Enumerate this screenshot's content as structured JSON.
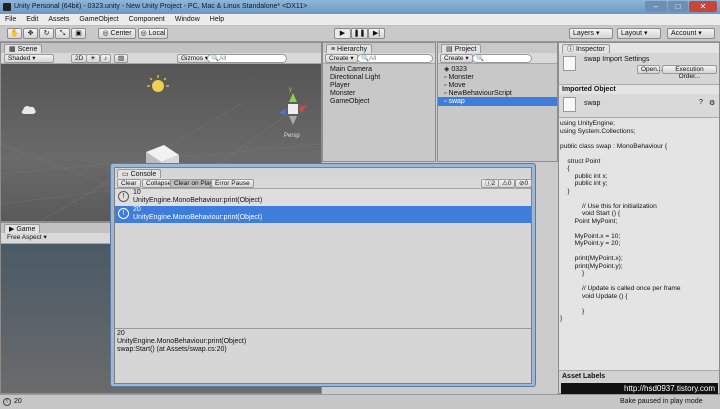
{
  "window": {
    "title": "Unity Personal (64bit) - 0323.unity - New Unity Project - PC, Mac & Linux Standalone* <DX11>"
  },
  "menu": [
    "File",
    "Edit",
    "Assets",
    "GameObject",
    "Component",
    "Window",
    "Help"
  ],
  "toolbar": {
    "center": "Center",
    "local": "Local",
    "layers": "Layers",
    "layout": "Layout",
    "account": "Account"
  },
  "scene": {
    "tab": "Scene",
    "shading": "Shaded",
    "mode2d": "2D",
    "gizmos": "Gizmos",
    "search": "All",
    "persp": "Persp"
  },
  "game": {
    "tab": "Game",
    "aspect": "Free Aspect"
  },
  "hierarchy": {
    "tab": "Hierarchy",
    "create": "Create",
    "search": "All",
    "items": [
      "Main Camera",
      "Directional Light",
      "Player",
      "Monster",
      "GameObject"
    ]
  },
  "project": {
    "tab": "Project",
    "create": "Create",
    "items": [
      "0323",
      "Monster",
      "Move",
      "NewBehaviourScript",
      "swap"
    ],
    "selected": 4
  },
  "inspector": {
    "tab": "Inspector",
    "title": "swap Import Settings",
    "open": "Open...",
    "exec": "Execution Order...",
    "imported": "Imported Object",
    "asset_name": "swap",
    "asset_labels": "Asset Labels",
    "watermark": "http://hsd0937.tistory.com",
    "code": [
      "using UnityEngine;",
      "using System.Collections;",
      "",
      "public class swap : MonoBehaviour {",
      "",
      "    struct Point",
      "    {",
      "        public int x;",
      "        public int y;",
      "    }",
      "",
      "            // Use this for initialization",
      "            void Start () {",
      "        Point MyPoint;",
      "",
      "        MyPoint.x = 10;",
      "        MyPoint.y = 20;",
      "",
      "        print(MyPoint.x);",
      "        print(MyPoint.y);",
      "            }",
      "",
      "            // Update is called once per frame",
      "            void Update () {",
      "",
      "            }",
      "}"
    ]
  },
  "console": {
    "tab": "Console",
    "buttons": [
      "Clear",
      "Collapse",
      "Clear on Play",
      "Error Pause"
    ],
    "counts": [
      "2",
      "0",
      "0"
    ],
    "entries": [
      {
        "line1": "10",
        "line2": "UnityEngine.MonoBehaviour:print(Object)"
      },
      {
        "line1": "20",
        "line2": "UnityEngine.MonoBehaviour:print(Object)"
      }
    ],
    "detail": [
      "20",
      "UnityEngine.MonoBehaviour:print(Object)",
      "swap:Start() (at Assets/swap.cs:20)"
    ]
  },
  "status": {
    "text": "20",
    "right": "Bake paused in play mode"
  },
  "colors": {
    "selection": "#3e7ddb",
    "scene_bg": "#5d5d5d",
    "console_bg": "#d6d6d6"
  }
}
